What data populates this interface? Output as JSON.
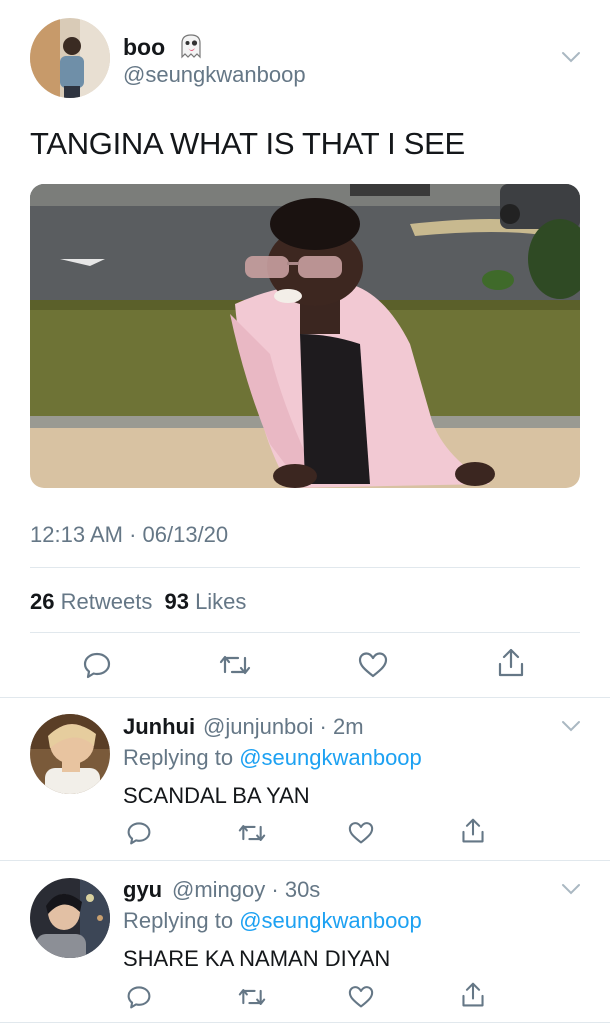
{
  "main_tweet": {
    "display_name": "boo",
    "name_emoji_icon": "ghost-icon",
    "handle": "@seungkwanboop",
    "text": "TANGINA WHAT IS THAT I SEE",
    "timestamp": "12:13 AM · 06/13/20",
    "retweets_count": "26",
    "retweets_label": "Retweets",
    "likes_count": "93",
    "likes_label": "Likes"
  },
  "replies": [
    {
      "display_name": "Junhui",
      "handle": "@junjunboi",
      "time": "· 2m",
      "replying_prefix": "Replying to",
      "replying_to": "@seungkwanboop",
      "text": "SCANDAL BA YAN"
    },
    {
      "display_name": "gyu",
      "handle": "@mingoy",
      "time": "· 30s",
      "replying_prefix": "Replying to",
      "replying_to": "@seungkwanboop",
      "text": "SHARE KA NAMAN DIYAN"
    }
  ],
  "colors": {
    "text": "#14171a",
    "secondary": "#657786",
    "link": "#1da1f2",
    "divider": "#e1e8ed"
  },
  "icons": [
    "reply-icon",
    "retweet-icon",
    "like-icon",
    "share-icon",
    "chevron-down-icon"
  ]
}
